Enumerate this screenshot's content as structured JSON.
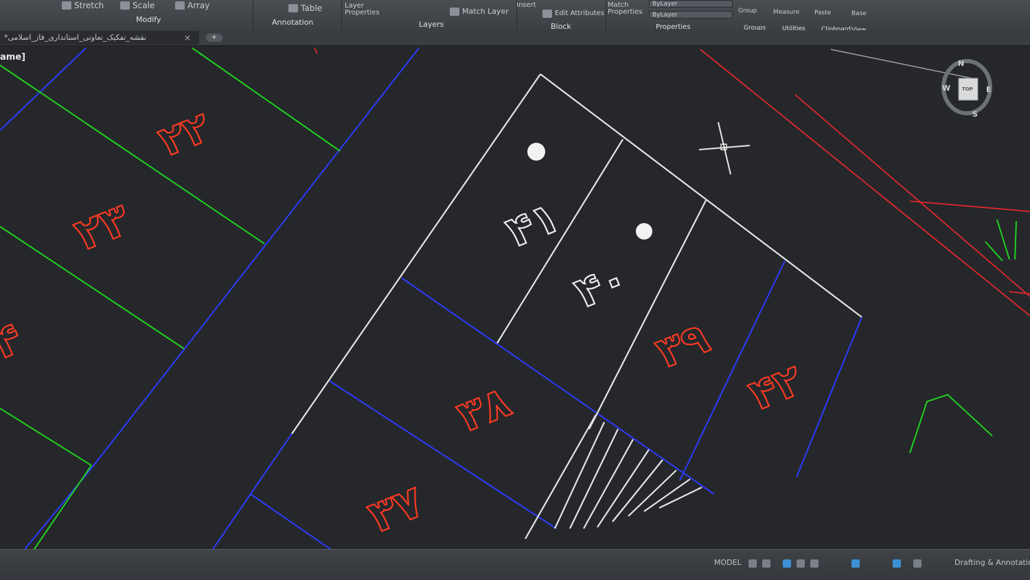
{
  "ribbon": {
    "modify": {
      "stretch": "Stretch",
      "scale": "Scale",
      "array": "Array",
      "panel": "Modify"
    },
    "annotation": {
      "table": "Table",
      "panel": "Annotation"
    },
    "layers": {
      "layer_properties": "Layer Properties",
      "match_layer": "Match Layer",
      "panel": "Layers"
    },
    "block": {
      "insert": "Insert",
      "edit_attributes": "Edit Attributes",
      "panel": "Block"
    },
    "properties": {
      "match_properties": "Match Properties",
      "bylayer_1": "ByLayer",
      "bylayer_2": "ByLayer",
      "panel": "Properties"
    },
    "groups": {
      "group": "Group",
      "panel": "Groups"
    },
    "utilities": {
      "measure": "Measure",
      "panel": "Utilities"
    },
    "clipboard": {
      "paste": "Paste",
      "panel": "Clipboard"
    },
    "view": {
      "base": "Base",
      "panel": "View"
    }
  },
  "document_tab": {
    "title": "نقشه_تفکیک_تعاونی_استانداری_فاز_اسلامی*",
    "close": "×",
    "new_tab": "+"
  },
  "viewport": {
    "label": "ame]"
  },
  "viewcube": {
    "north": "N",
    "south": "S",
    "east": "E",
    "west": "W",
    "top": "TOP"
  },
  "lots": {
    "lot_22": "۲۲",
    "lot_23": "۲۳",
    "lot_partial_left": "۴",
    "lot_41": "۴۱",
    "lot_40": "۴۰",
    "lot_39": "۳۹",
    "lot_38": "۳۸",
    "lot_37": "۳۷",
    "lot_42": "۴۲"
  },
  "colors": {
    "background": "#26272b",
    "lot_text": "#ff3b22",
    "boundary_white": "#e6e6e6",
    "lot_line_blue": "#2b3cff",
    "lot_line_green": "#1fd21f",
    "road_red": "#e0282c"
  },
  "statusbar": {
    "model": "MODEL",
    "workspace": "Drafting & Annotation"
  }
}
